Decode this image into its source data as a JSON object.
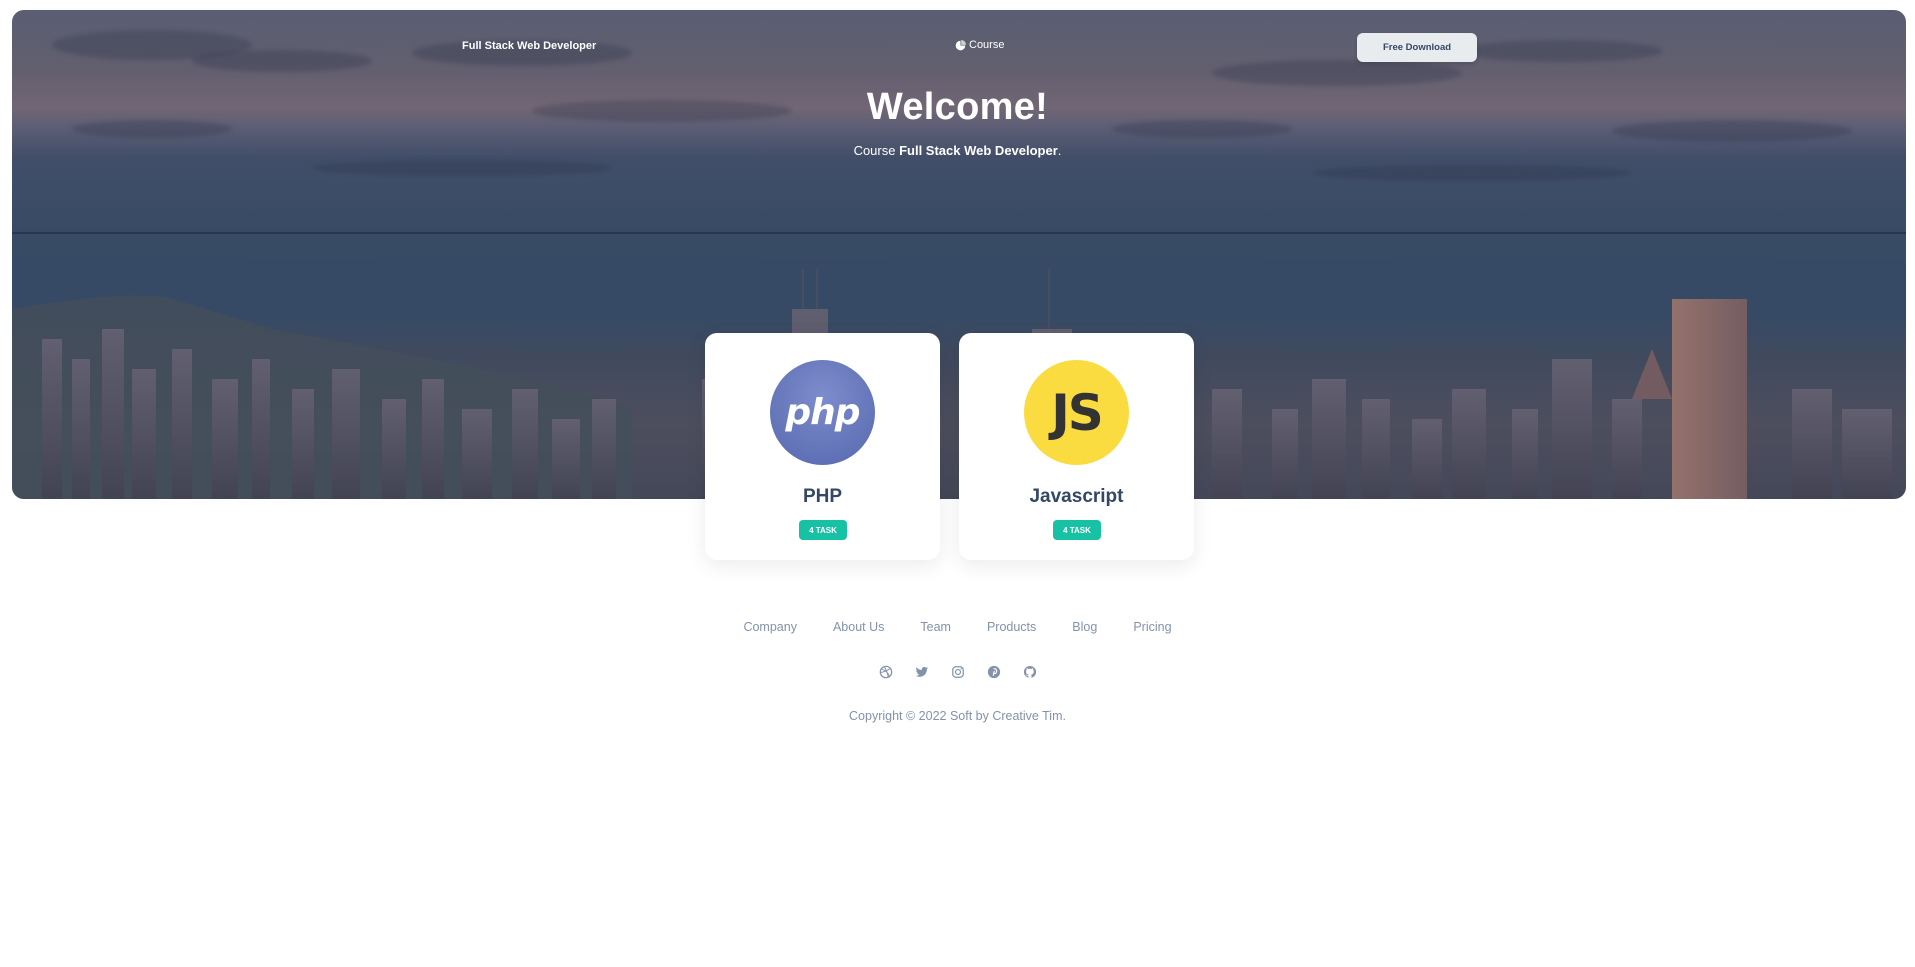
{
  "navbar": {
    "brand": "Full Stack Web Developer",
    "course_link": "Course",
    "download_button": "Free Download"
  },
  "hero": {
    "title": "Welcome!",
    "subtitle_prefix": "Course ",
    "subtitle_bold": "Full Stack Web Developer",
    "subtitle_suffix": "."
  },
  "cards": [
    {
      "logo_text": "php",
      "title": "PHP",
      "badge": "4 TASK"
    },
    {
      "logo_text": "JS",
      "title": "Javascript",
      "badge": "4 TASK"
    }
  ],
  "footer": {
    "links": [
      "Company",
      "About Us",
      "Team",
      "Products",
      "Blog",
      "Pricing"
    ],
    "social_icons": [
      "dribbble-icon",
      "twitter-icon",
      "instagram-icon",
      "pinterest-icon",
      "github-icon"
    ],
    "copyright": "Copyright © 2022 Soft by Creative Tim."
  },
  "colors": {
    "primary_text": "#344767",
    "muted_text": "#8392ab",
    "badge_success": "#17c1a4",
    "php_logo": "#6778bb",
    "js_logo": "#fbdc40"
  }
}
